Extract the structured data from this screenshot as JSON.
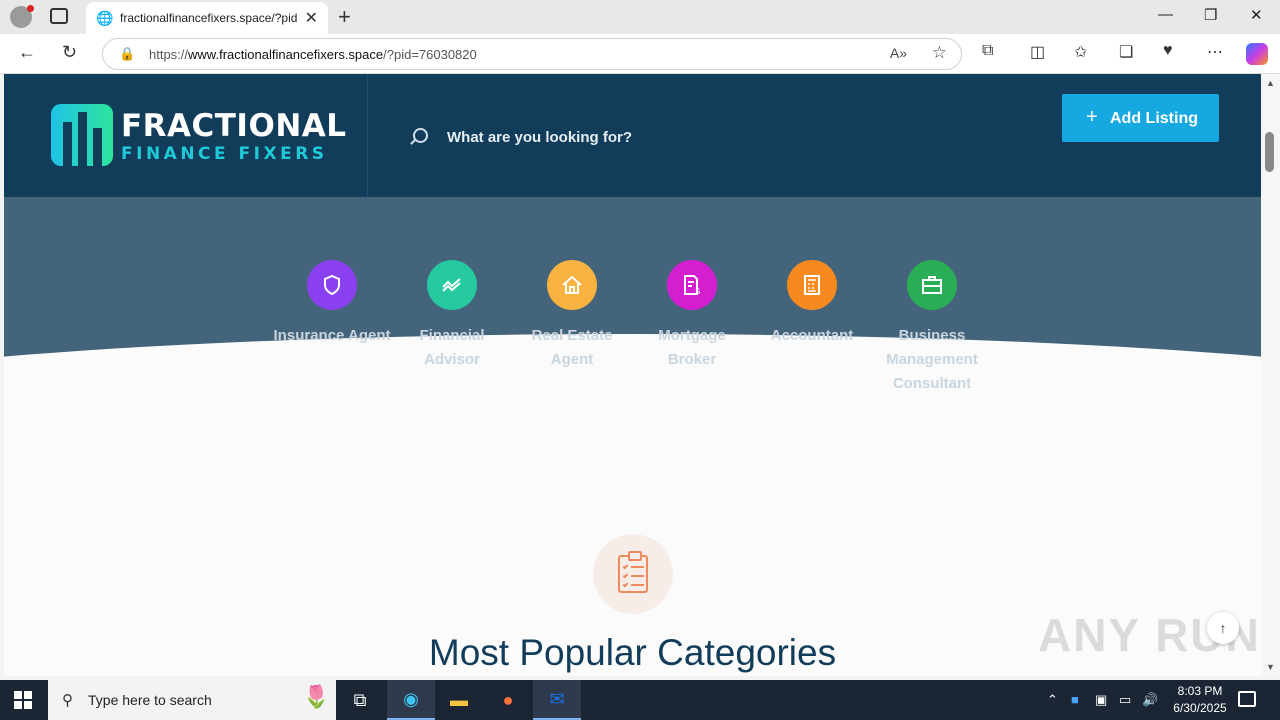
{
  "browser": {
    "tab_title": "fractionalfinancefixers.space/?pid=76030820",
    "url_prefix": "https://",
    "url_host": "www.fractionalfinancefixers.space",
    "url_path": "/?pid=76030820"
  },
  "site": {
    "logo_line1": "FRACTIONAL",
    "logo_line2": "FINANCE FIXERS",
    "search_placeholder": "What are you looking for?",
    "add_listing": "Add Listing"
  },
  "categories": [
    {
      "label": "Insurance Agent",
      "icon": "shield-icon",
      "color": "#8a3ff0"
    },
    {
      "label": "Financial Advisor",
      "icon": "trend-icon",
      "color": "#27c9a0"
    },
    {
      "label": "Real Estate Agent",
      "icon": "house-icon",
      "color": "#f7b240"
    },
    {
      "label": "Mortgage Broker",
      "icon": "document-dollar-icon",
      "color": "#d41fd0"
    },
    {
      "label": "Accountant",
      "icon": "calculator-icon",
      "color": "#f78a1f"
    },
    {
      "label": "Business Management Consultant",
      "icon": "briefcase-icon",
      "color": "#2aae55"
    }
  ],
  "section": {
    "popular_title": "Most Popular Categories"
  },
  "watermark": "ANY RUN",
  "taskbar": {
    "search_placeholder": "Type here to search",
    "time": "8:03 PM",
    "date": "6/30/2025"
  }
}
